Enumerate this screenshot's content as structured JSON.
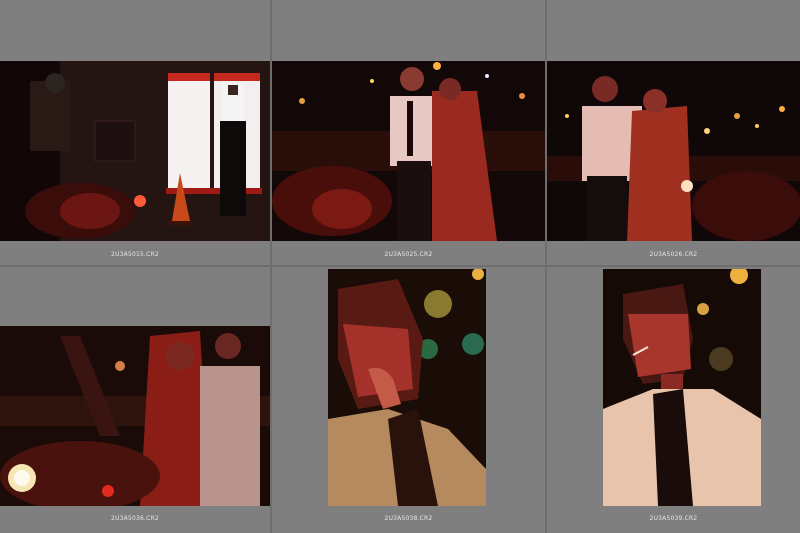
{
  "browser": {
    "thumbnails": [
      {
        "filename": "2U3A5015.CR2",
        "scene": "rider-on-motorcycle-beside-lightbox-and-man-in-white-shirt"
      },
      {
        "filename": "2U3A5025.CR2",
        "scene": "couple-standing-by-motorcycle-at-night"
      },
      {
        "filename": "2U3A5026.CR2",
        "scene": "couple-leaning-on-railing-city-lights"
      },
      {
        "filename": "2U3A5036.CR2",
        "scene": "couple-behind-motorcycle-headlight"
      },
      {
        "filename": "2U3A5038.CR2",
        "scene": "man-closeup-hand-to-mouth-bokeh"
      },
      {
        "filename": "2U3A5039.CR2",
        "scene": "man-smoking-white-shirt-loose-tie"
      }
    ]
  },
  "colors": {
    "background": "#7f7f7f",
    "separator": "#6e6e6e",
    "filename_text": "#e6e6e6",
    "red_light": "#c0281e"
  }
}
